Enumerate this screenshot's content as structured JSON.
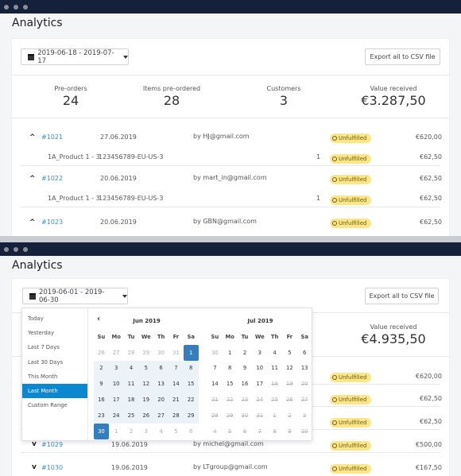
{
  "top": {
    "title": "Analytics",
    "date_range": "2019-06-18 - 2019-07-17",
    "export_label": "Export all to CSV file",
    "stats": [
      {
        "label": "Pre-orders",
        "value": "24"
      },
      {
        "label": "Items pre-ordered",
        "value": "28"
      },
      {
        "label": "Customers",
        "value": "3"
      },
      {
        "label": "Value received",
        "value": "€3.287,50"
      }
    ],
    "orders": [
      {
        "id": "#1021",
        "date": "27.06.2019",
        "by": "by HJ@gmail.com",
        "status": "Unfulfilled",
        "amount": "€620,00",
        "item": {
          "name": "1A_Product 1 - 3",
          "sku": "123456789-EU-US-3",
          "qty": "1",
          "status": "Unfulfilled",
          "amount": "€62,50"
        }
      },
      {
        "id": "#1022",
        "date": "20.06.2019",
        "by": "by mart_in@gmail.com",
        "status": "Unfulfilled",
        "amount": "€62,50",
        "item": {
          "name": "1A_Product 1 - 3",
          "sku": "123456789-EU-US-3",
          "qty": "1",
          "status": "Unfulfilled",
          "amount": "€62,50"
        }
      },
      {
        "id": "#1023",
        "date": "20.06.2019",
        "by": "by GBN@gmail.com",
        "status": "Unfulfilled",
        "amount": "€62,50"
      }
    ]
  },
  "bottom": {
    "title": "Analytics",
    "date_range": "2019-06-01 - 2019-06-30",
    "export_label": "Export all to CSV file",
    "value_label": "Value received",
    "value": "€4.935,50",
    "ranges": [
      "Today",
      "Yesterday",
      "Last 7 Days",
      "Last 30 Days",
      "This Month",
      "Last Month",
      "Custom Range"
    ],
    "active_range": "Last Month",
    "weekdays": [
      "Su",
      "Mo",
      "Tu",
      "We",
      "Th",
      "Fr",
      "Sa"
    ],
    "months": [
      {
        "title": "Jun 2019",
        "days": [
          [
            "26",
            "off"
          ],
          [
            "27",
            "off"
          ],
          [
            "28",
            "off"
          ],
          [
            "29",
            "off"
          ],
          [
            "30",
            "off"
          ],
          [
            "31",
            "off"
          ],
          [
            "1",
            "sel"
          ],
          [
            "2",
            "in"
          ],
          [
            "3",
            "in"
          ],
          [
            "4",
            "in"
          ],
          [
            "5",
            "in"
          ],
          [
            "6",
            "in"
          ],
          [
            "7",
            "in"
          ],
          [
            "8",
            "in"
          ],
          [
            "9",
            "in"
          ],
          [
            "10",
            "in"
          ],
          [
            "11",
            "in"
          ],
          [
            "12",
            "in"
          ],
          [
            "13",
            "in"
          ],
          [
            "14",
            "in"
          ],
          [
            "15",
            "in"
          ],
          [
            "16",
            "in"
          ],
          [
            "17",
            "in"
          ],
          [
            "18",
            "in"
          ],
          [
            "19",
            "in"
          ],
          [
            "20",
            "in"
          ],
          [
            "21",
            "in"
          ],
          [
            "22",
            "in"
          ],
          [
            "23",
            "in"
          ],
          [
            "24",
            "in"
          ],
          [
            "25",
            "in"
          ],
          [
            "26",
            "in"
          ],
          [
            "27",
            "in"
          ],
          [
            "28",
            "in"
          ],
          [
            "29",
            "in"
          ],
          [
            "30",
            "sel"
          ],
          [
            "1",
            "off"
          ],
          [
            "2",
            "off"
          ],
          [
            "3",
            "off"
          ],
          [
            "4",
            "off"
          ],
          [
            "5",
            "off"
          ],
          [
            "6",
            "off"
          ]
        ]
      },
      {
        "title": "Jul 2019",
        "days": [
          [
            "30",
            "off"
          ],
          [
            "1",
            ""
          ],
          [
            "2",
            ""
          ],
          [
            "3",
            ""
          ],
          [
            "4",
            ""
          ],
          [
            "5",
            ""
          ],
          [
            "6",
            ""
          ],
          [
            "7",
            ""
          ],
          [
            "8",
            ""
          ],
          [
            "9",
            ""
          ],
          [
            "10",
            ""
          ],
          [
            "11",
            ""
          ],
          [
            "12",
            ""
          ],
          [
            "13",
            ""
          ],
          [
            "14",
            ""
          ],
          [
            "15",
            ""
          ],
          [
            "16",
            ""
          ],
          [
            "17",
            ""
          ],
          [
            "18",
            "dis"
          ],
          [
            "19",
            "dis"
          ],
          [
            "20",
            "dis"
          ],
          [
            "21",
            "dis"
          ],
          [
            "22",
            "dis"
          ],
          [
            "23",
            "dis"
          ],
          [
            "24",
            "dis"
          ],
          [
            "25",
            "dis"
          ],
          [
            "26",
            "dis"
          ],
          [
            "27",
            "dis"
          ],
          [
            "28",
            "dis"
          ],
          [
            "29",
            "dis"
          ],
          [
            "30",
            "dis"
          ],
          [
            "31",
            "dis"
          ],
          [
            "1",
            "dis"
          ],
          [
            "2",
            "dis"
          ],
          [
            "3",
            "dis"
          ],
          [
            "4",
            "dis"
          ],
          [
            "5",
            "dis"
          ],
          [
            "6",
            "dis"
          ],
          [
            "7",
            "dis"
          ],
          [
            "8",
            "dis"
          ],
          [
            "9",
            "dis"
          ],
          [
            "10",
            "dis"
          ]
        ]
      }
    ],
    "rows": [
      {
        "status": "Unfulfilled",
        "amount": "€620,00"
      },
      {
        "status": "Unfulfilled",
        "amount": "€62,50"
      },
      {
        "status": "Unfulfilled",
        "amount": "€62,50"
      },
      {
        "id": "#1029",
        "date": "19.06.2019",
        "by": "by michel@gmail.com",
        "status": "Unfulfilled",
        "amount": "€500,00"
      },
      {
        "id": "#1030",
        "date": "19.06.2019",
        "by": "by LTgroup@gmail.com",
        "status": "Unfulfilled",
        "amount": "€167,50"
      }
    ]
  },
  "colors": {
    "topbar": "#15213a",
    "accent": "#357ebd",
    "active_range": "#0a87cf",
    "badge": "#fde68a",
    "link": "#3b8fd1"
  }
}
